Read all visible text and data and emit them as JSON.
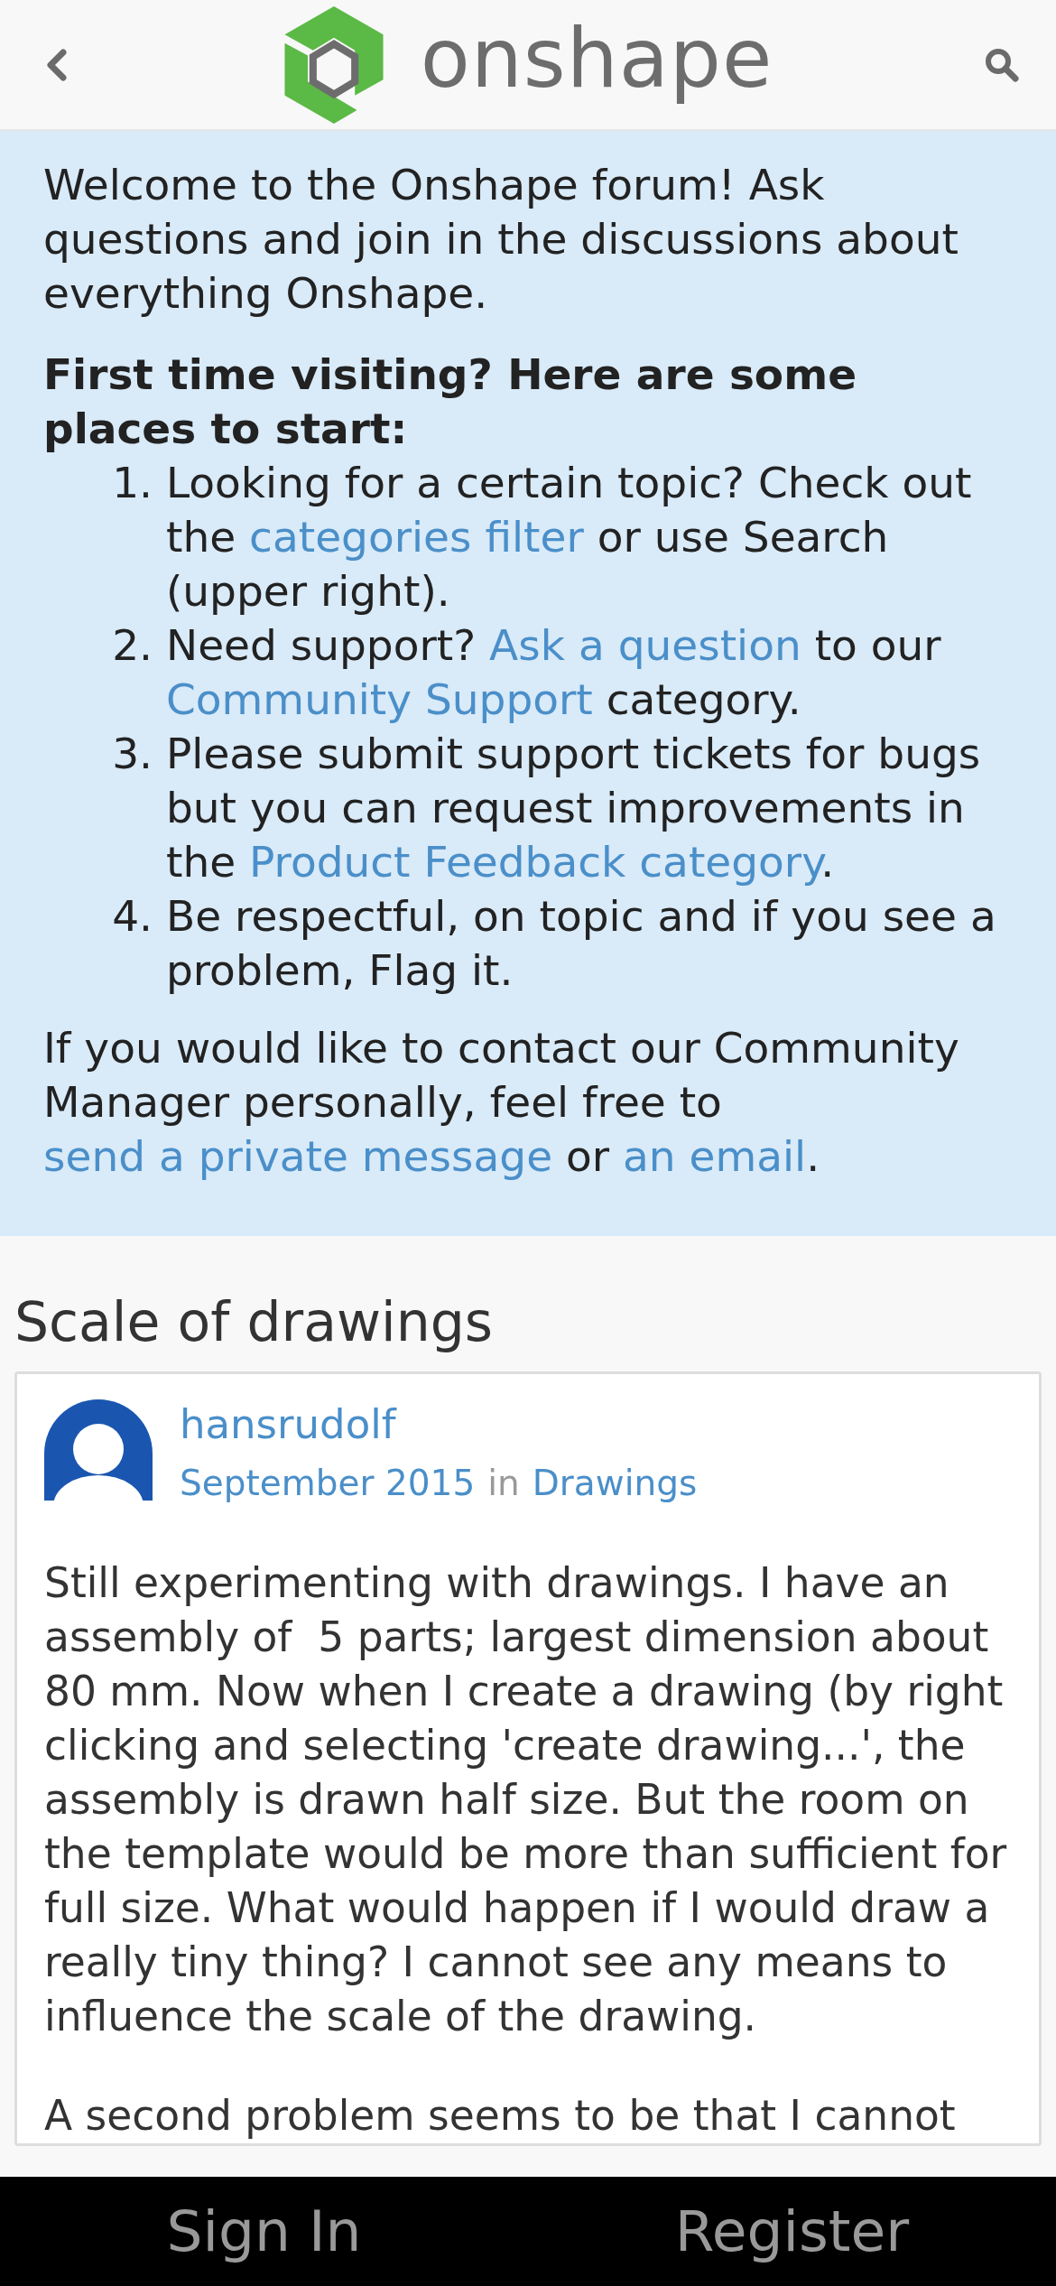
{
  "header": {
    "brand": "onshape"
  },
  "welcome": {
    "intro": "Welcome to the Onshape forum! Ask questions and join in the discussions about everything Onshape.",
    "heading": "First time visiting? Here are some places to start:",
    "steps": [
      {
        "number": "1.",
        "parts": [
          {
            "text": "Looking for a certain topic? Check out the ",
            "link": false
          },
          {
            "text": "categories filter",
            "link": true
          },
          {
            "text": " or use Search (upper right).",
            "link": false
          }
        ]
      },
      {
        "number": "2.",
        "parts": [
          {
            "text": "Need support? ",
            "link": false
          },
          {
            "text": "Ask a question",
            "link": true
          },
          {
            "text": " to our ",
            "link": false
          },
          {
            "text": "Community Support",
            "link": true
          },
          {
            "text": " category.",
            "link": false
          }
        ]
      },
      {
        "number": "3.",
        "parts": [
          {
            "text": "Please submit support tickets for bugs but you can request improvements in the ",
            "link": false
          },
          {
            "text": "Product Feedback category",
            "link": true
          },
          {
            "text": ".",
            "link": false
          }
        ]
      },
      {
        "number": "4.",
        "parts": [
          {
            "text": "Be respectful, on topic and if you see a problem, Flag it.",
            "link": false
          }
        ]
      }
    ],
    "contact": [
      {
        "text": "If you would like to contact our Community Manager personally, feel free to ",
        "link": false
      },
      {
        "text": "send a private message",
        "link": true
      },
      {
        "text": " or ",
        "link": false
      },
      {
        "text": "an email",
        "link": true
      },
      {
        "text": ".",
        "link": false
      }
    ]
  },
  "discussion": {
    "title": "Scale of drawings",
    "author": "hansrudolf",
    "date": "September 2015",
    "in_word": "in",
    "category": "Drawings",
    "paragraphs": [
      "Still experimenting with drawings. I have an assembly of  5 parts; largest dimension about 80 mm. Now when I create a drawing (by right clicking and selecting 'create drawing...', the assembly is drawn half size. But the room on the template would be more than sufficient for full size. What would happen if I would draw a really tiny thing? I cannot see any means to influence the scale of the drawing.",
      "A second problem seems to be that I cannot"
    ]
  },
  "footer": {
    "buttons": [
      "Sign In",
      "Register"
    ]
  }
}
